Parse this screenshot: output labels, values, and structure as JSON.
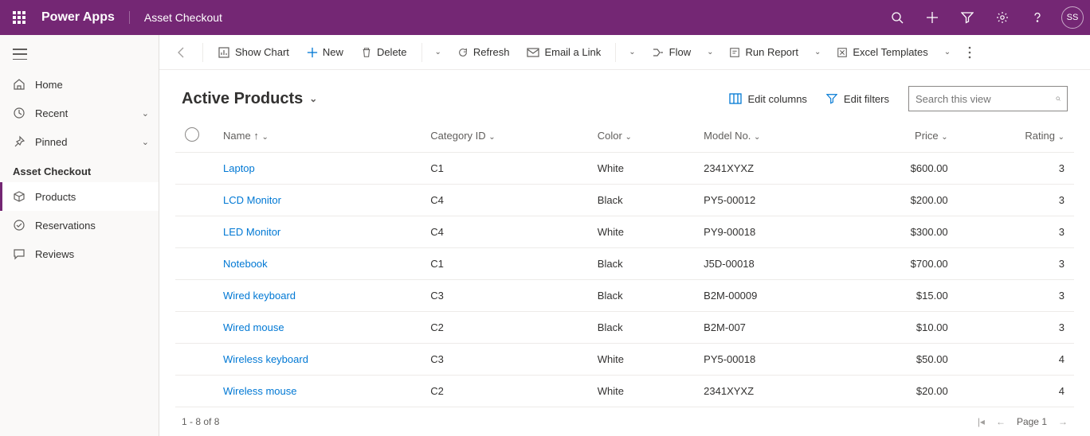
{
  "header": {
    "app_title": "Power Apps",
    "breadcrumb": "Asset Checkout",
    "avatar": "SS"
  },
  "sidebar": {
    "nav": {
      "home": "Home",
      "recent": "Recent",
      "pinned": "Pinned"
    },
    "section_title": "Asset Checkout",
    "items": {
      "products": "Products",
      "reservations": "Reservations",
      "reviews": "Reviews"
    }
  },
  "commands": {
    "show_chart": "Show Chart",
    "new": "New",
    "delete": "Delete",
    "refresh": "Refresh",
    "email_link": "Email a Link",
    "flow": "Flow",
    "run_report": "Run Report",
    "excel_templates": "Excel Templates"
  },
  "view": {
    "title": "Active Products",
    "edit_columns": "Edit columns",
    "edit_filters": "Edit filters",
    "search_placeholder": "Search this view"
  },
  "columns": {
    "name": "Name",
    "category": "Category ID",
    "color": "Color",
    "model": "Model No.",
    "price": "Price",
    "rating": "Rating"
  },
  "rows": [
    {
      "name": "Laptop",
      "category": "C1",
      "color": "White",
      "model": "2341XYXZ",
      "price": "$600.00",
      "rating": "3"
    },
    {
      "name": "LCD Monitor",
      "category": "C4",
      "color": "Black",
      "model": "PY5-00012",
      "price": "$200.00",
      "rating": "3"
    },
    {
      "name": "LED Monitor",
      "category": "C4",
      "color": "White",
      "model": "PY9-00018",
      "price": "$300.00",
      "rating": "3"
    },
    {
      "name": "Notebook",
      "category": "C1",
      "color": "Black",
      "model": "J5D-00018",
      "price": "$700.00",
      "rating": "3"
    },
    {
      "name": "Wired keyboard",
      "category": "C3",
      "color": "Black",
      "model": "B2M-00009",
      "price": "$15.00",
      "rating": "3"
    },
    {
      "name": "Wired mouse",
      "category": "C2",
      "color": "Black",
      "model": "B2M-007",
      "price": "$10.00",
      "rating": "3"
    },
    {
      "name": "Wireless keyboard",
      "category": "C3",
      "color": "White",
      "model": "PY5-00018",
      "price": "$50.00",
      "rating": "4"
    },
    {
      "name": "Wireless mouse",
      "category": "C2",
      "color": "White",
      "model": "2341XYXZ",
      "price": "$20.00",
      "rating": "4"
    }
  ],
  "footer": {
    "range": "1 - 8 of 8",
    "page_label": "Page 1"
  }
}
